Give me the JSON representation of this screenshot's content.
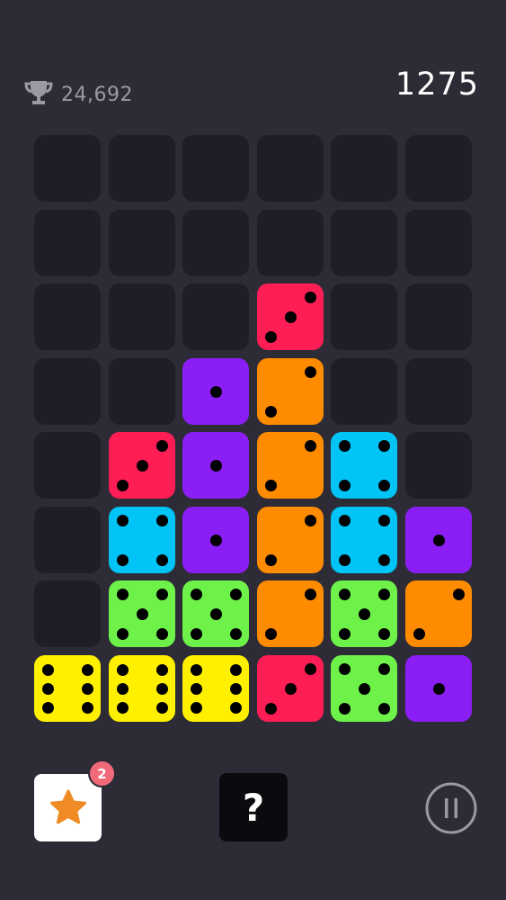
{
  "header": {
    "best_score": "24,692",
    "best_icon": "trophy-icon",
    "score": "1275"
  },
  "board": {
    "columns": 6,
    "rows": 8,
    "grid": [
      [
        0,
        0,
        0,
        0,
        0,
        0
      ],
      [
        0,
        0,
        0,
        0,
        0,
        0
      ],
      [
        0,
        0,
        0,
        3,
        0,
        0
      ],
      [
        0,
        0,
        1,
        2,
        0,
        0
      ],
      [
        0,
        3,
        1,
        2,
        4,
        0
      ],
      [
        0,
        4,
        1,
        2,
        4,
        1
      ],
      [
        0,
        5,
        5,
        2,
        5,
        2
      ],
      [
        6,
        6,
        6,
        3,
        5,
        1
      ]
    ],
    "face_colors": {
      "1": "#8b1ef5",
      "2": "#ff8b00",
      "3": "#ff1d55",
      "4": "#00c4f5",
      "5": "#6ef24a",
      "6": "#fff000"
    },
    "empty_color": "#1f1e26"
  },
  "controls": {
    "star_icon": "star-icon",
    "star_badge": "2",
    "help_label": "?",
    "pause_icon": "pause-icon"
  },
  "colors": {
    "background": "#2d2c36",
    "badge": "#f06a7a",
    "star": "#f08a24"
  }
}
